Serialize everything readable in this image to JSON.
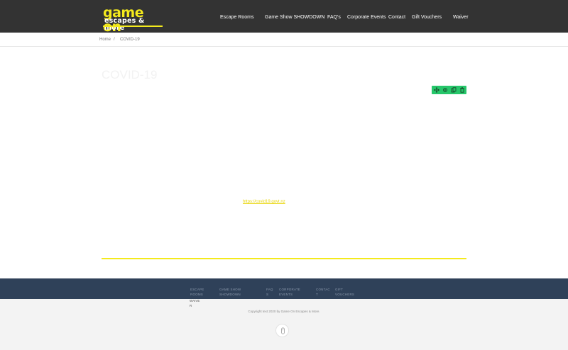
{
  "brand": {
    "logo_top": "game on",
    "logo_bottom": "escapes & more",
    "colors": {
      "yellow": "#f4ea1d",
      "header_bg": "#333333",
      "footer_nav_bg": "#2f4159",
      "tool_green": "#26c66a"
    }
  },
  "nav": {
    "items": [
      "Escape Rooms",
      "Game Show SHOWDOWN",
      "FAQ's",
      "Corporate Events",
      "Contact",
      "Gift Vouchers",
      "Waiver"
    ]
  },
  "breadcrumb": {
    "home": "Home",
    "separator": "/",
    "current": "COVID-19"
  },
  "page": {
    "title": "COVID-19",
    "link_text": "https://covid19.govt.nz"
  },
  "toolbox": {
    "icons": [
      "move-icon",
      "settings-icon",
      "copy-icon",
      "delete-icon"
    ]
  },
  "footer": {
    "nav": {
      "escape_rooms": "ESCAPE\nROOMS",
      "game_show": "GAME SHOW\nSHOWDOWN",
      "faqs": "FAQ\nS",
      "corporate": "CORPORATE\nEVENTS",
      "contact": "CONTAC\nT",
      "vouchers": "GIFT\nVOUCHERS",
      "waiver": "WAIVE\nR"
    },
    "copyright": "Copyright text 2020 by Game On Escapes & More.",
    "scroll_top_icon": "arrow-up-icon"
  }
}
